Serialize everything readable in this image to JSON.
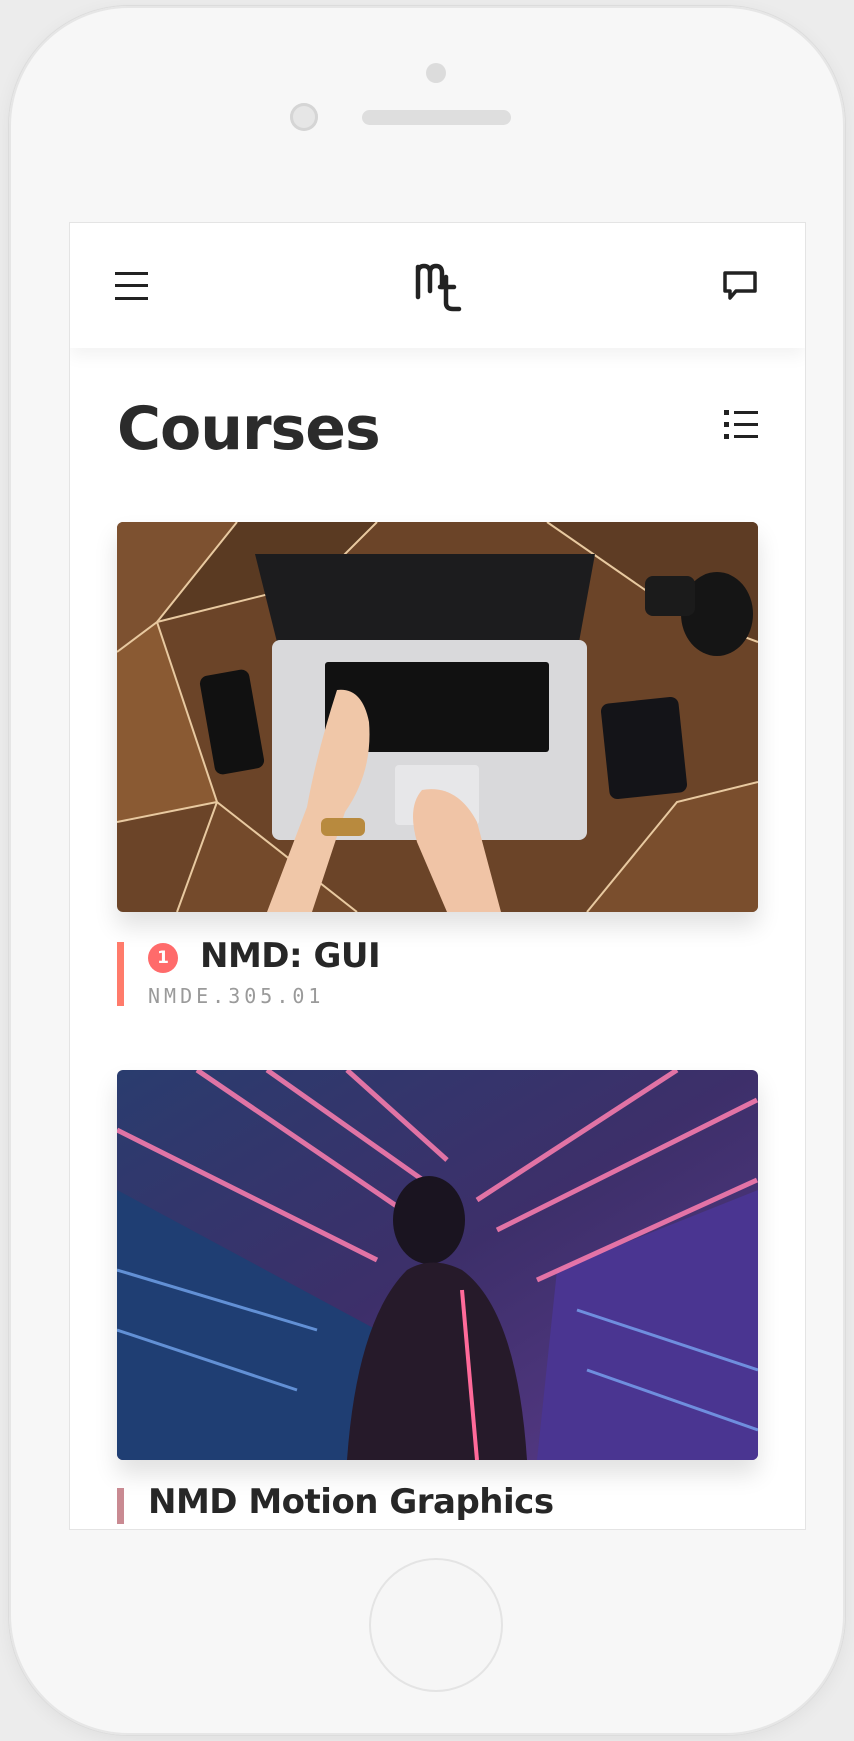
{
  "header": {
    "logo_text": "mc",
    "menu_icon": "hamburger-icon",
    "chat_icon": "chat-bubble-icon"
  },
  "page": {
    "title": "Courses",
    "view_toggle_icon": "list-view-icon"
  },
  "courses": [
    {
      "badge": "1",
      "title": "NMD: GUI",
      "code": "NMDE.305.01",
      "image": "laptop-desk-photo",
      "accent_color": "#ff7b6b"
    },
    {
      "title": "NMD Motion Graphics",
      "image": "neon-figure-photo",
      "accent_color": "#c98a92"
    }
  ],
  "colors": {
    "badge": "#ff6b6b",
    "text": "#272727",
    "muted": "#9a9a9a"
  }
}
